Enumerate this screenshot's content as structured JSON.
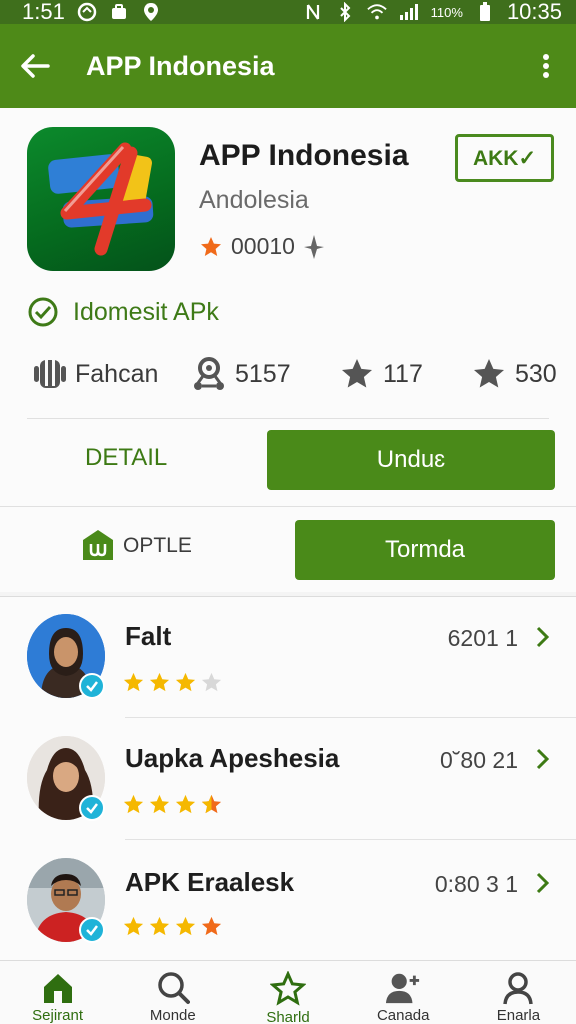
{
  "status_bar": {
    "time_left": "1:51",
    "battery": "110%",
    "time_right": "10:35"
  },
  "app_bar": {
    "title": "APP Indonesia"
  },
  "app": {
    "name": "APP Indonesia",
    "developer": "Andolesia",
    "rating_count": "00010",
    "tag_button": "AKK✓",
    "verified_label": "Idomesit APk"
  },
  "stats": [
    {
      "icon": "android-icon",
      "value": "Fahcan"
    },
    {
      "icon": "network-icon",
      "value": "5157"
    },
    {
      "icon": "star-icon",
      "value": "117"
    },
    {
      "icon": "star-icon",
      "value": "530"
    }
  ],
  "actions": {
    "detail_label": "DETAIL",
    "primary_label": "Unduɛ",
    "option_label": "OPTLE",
    "secondary_label": "Tormda"
  },
  "reviews": [
    {
      "name": "Falt",
      "value": "6201 1",
      "stars_filled": 3,
      "stars_total": 4
    },
    {
      "name": "Uapka Apeshesia",
      "value": "0˘80 21",
      "stars_filled": 4,
      "stars_total": 4
    },
    {
      "name": "APK Eraalesk",
      "value": "0:80 3 1",
      "stars_filled": 4,
      "stars_total": 4
    }
  ],
  "bottom_nav": [
    {
      "label": "Sejirant",
      "icon": "home-icon",
      "active": true
    },
    {
      "label": "Monde",
      "icon": "search-icon",
      "active": false
    },
    {
      "label": "Sharld",
      "icon": "star-icon",
      "active": true
    },
    {
      "label": "Canada",
      "icon": "add-person-icon",
      "active": false
    },
    {
      "label": "Enarla",
      "icon": "profile-icon",
      "active": false
    }
  ],
  "colors": {
    "primary": "#4e8a18",
    "status_bar": "#3f6f1c",
    "accent_star": "#f5b800",
    "accent_star_orange": "#f06a1a"
  }
}
